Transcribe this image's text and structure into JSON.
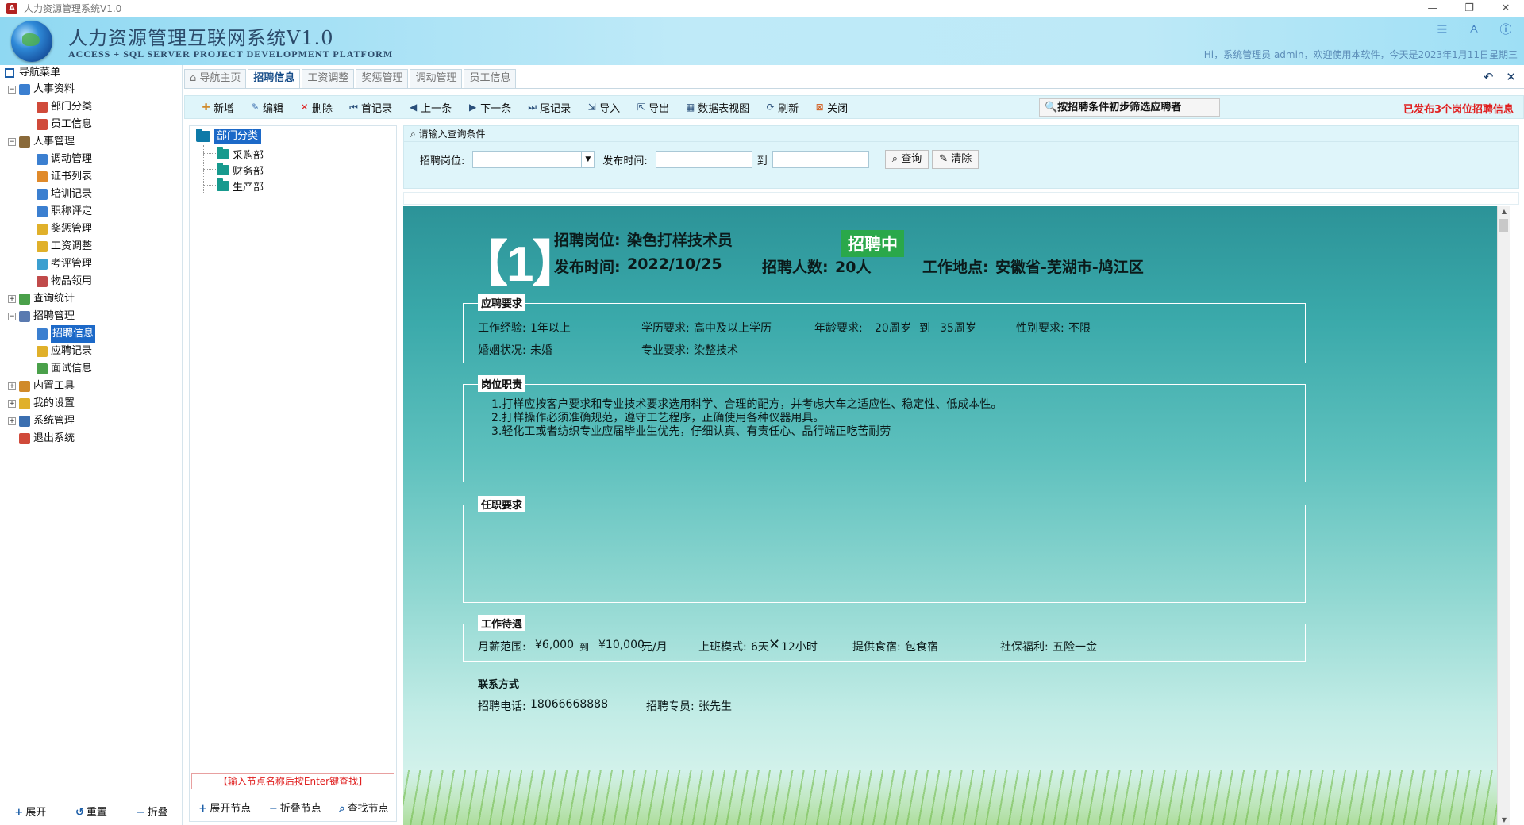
{
  "window": {
    "title": "人力资源管理系统V1.0",
    "app_badge": "A"
  },
  "banner": {
    "title": "人力资源管理互联网系统V1.0",
    "subtitle": "ACCESS + SQL SERVER PROJECT DEVELOPMENT PLATFORM",
    "welcome": "Hi，系统管理员 admin，欢迎使用本软件，今天是2023年1月11日星期三"
  },
  "nav": {
    "header": "导航菜单",
    "items": [
      {
        "label": "人事资料",
        "level": 0,
        "exp": "−",
        "color": "#3b7fd0"
      },
      {
        "label": "部门分类",
        "level": 1,
        "color": "#d04a3a"
      },
      {
        "label": "员工信息",
        "level": 1,
        "color": "#d04a3a"
      },
      {
        "label": "人事管理",
        "level": 0,
        "exp": "−",
        "color": "#8a6a3a"
      },
      {
        "label": "调动管理",
        "level": 1,
        "color": "#3b7fd0"
      },
      {
        "label": "证书列表",
        "level": 1,
        "color": "#e08a2a"
      },
      {
        "label": "培训记录",
        "level": 1,
        "color": "#3b7fd0"
      },
      {
        "label": "职称评定",
        "level": 1,
        "color": "#3b7fd0"
      },
      {
        "label": "奖惩管理",
        "level": 1,
        "color": "#e0b02a"
      },
      {
        "label": "工资调整",
        "level": 1,
        "color": "#e0b02a"
      },
      {
        "label": "考评管理",
        "level": 1,
        "color": "#3b9fd0"
      },
      {
        "label": "物品领用",
        "level": 1,
        "color": "#c04a4a"
      },
      {
        "label": "查询统计",
        "level": 0,
        "exp": "+",
        "color": "#4aa04a"
      },
      {
        "label": "招聘管理",
        "level": 0,
        "exp": "−",
        "color": "#5a7ab0"
      },
      {
        "label": "招聘信息",
        "level": 1,
        "color": "#3b7fd0",
        "selected": true
      },
      {
        "label": "应聘记录",
        "level": 1,
        "color": "#e0b02a"
      },
      {
        "label": "面试信息",
        "level": 1,
        "color": "#4aa04a"
      },
      {
        "label": "内置工具",
        "level": 0,
        "exp": "+",
        "color": "#d08a2a"
      },
      {
        "label": "我的设置",
        "level": 0,
        "exp": "+",
        "color": "#e0b02a"
      },
      {
        "label": "系统管理",
        "level": 0,
        "exp": "+",
        "color": "#3b6fb0"
      },
      {
        "label": "退出系统",
        "level": 0,
        "color": "#d04a3a"
      }
    ],
    "bottom": {
      "expand": "展开",
      "reset": "重置",
      "collapse": "折叠"
    }
  },
  "tabs": [
    {
      "label": "导航主页",
      "active": false
    },
    {
      "label": "招聘信息",
      "active": true
    },
    {
      "label": "工资调整",
      "active": false
    },
    {
      "label": "奖惩管理",
      "active": false
    },
    {
      "label": "调动管理",
      "active": false
    },
    {
      "label": "员工信息",
      "active": false
    }
  ],
  "toolbar": {
    "buttons": [
      {
        "label": "新增",
        "icon": "new-icon"
      },
      {
        "label": "编辑",
        "icon": "edit-icon"
      },
      {
        "label": "删除",
        "icon": "delete-icon"
      },
      {
        "label": "首记录",
        "icon": "first-record-icon"
      },
      {
        "label": "上一条",
        "icon": "prev-icon"
      },
      {
        "label": "下一条",
        "icon": "next-icon"
      },
      {
        "label": "尾记录",
        "icon": "last-record-icon"
      },
      {
        "label": "导入",
        "icon": "import-icon"
      },
      {
        "label": "导出",
        "icon": "export-icon"
      },
      {
        "label": "数据表视图",
        "icon": "datasheet-icon"
      },
      {
        "label": "刷新",
        "icon": "refresh-icon"
      },
      {
        "label": "关闭",
        "icon": "close-icon"
      }
    ],
    "filter_label": "按招聘条件初步筛选应聘者",
    "notice": "已发布3个岗位招聘信息"
  },
  "dept": {
    "root": "部门分类",
    "children": [
      "采购部",
      "财务部",
      "生产部"
    ],
    "hint": "【输入节点名称后按Enter键查找】",
    "bottom": {
      "expand": "展开节点",
      "collapse": "折叠节点",
      "find": "查找节点"
    }
  },
  "query": {
    "header": "请输入查询条件",
    "position_label": "招聘岗位:",
    "position_value": "",
    "time_label": "发布时间:",
    "time_from": "",
    "to_label": "到",
    "time_to": "",
    "search_btn": "查询",
    "clear_btn": "清除"
  },
  "job": {
    "index": "【1】",
    "position_label": "招聘岗位:",
    "position": "染色打样技术员",
    "status": "招聘中",
    "date_label": "发布时间:",
    "date": "2022/10/25",
    "count_label": "招聘人数:",
    "count": "20人",
    "location_label": "工作地点:",
    "location": "安徽省-芜湖市-鸠江区",
    "requirements": {
      "caption": "应聘要求",
      "exp_label": "工作经验:",
      "exp": "1年以上",
      "edu_label": "学历要求:",
      "edu": "高中及以上学历",
      "age_label": "年龄要求:",
      "age_from": "20周岁",
      "age_to_label": "到",
      "age_to": "35周岁",
      "gender_label": "性别要求:",
      "gender": "不限",
      "marital_label": "婚姻状况:",
      "marital": "未婚",
      "major_label": "专业要求:",
      "major": "染整技术"
    },
    "duties": {
      "caption": "岗位职责",
      "lines": [
        "1.打样应按客户要求和专业技术要求选用科学、合理的配方，并考虑大车之适应性、稳定性、低成本性。",
        "2.打样操作必须准确规范，遵守工艺程序，正确使用各种仪器用具。",
        "3.轻化工或者纺织专业应届毕业生优先，仔细认真、有责任心、品行端正吃苦耐劳"
      ]
    },
    "qualifications": {
      "caption": "任职要求"
    },
    "benefits": {
      "caption": "工作待遇",
      "salary_label": "月薪范围:",
      "salary_from": "¥6,000",
      "salary_to_label": "到",
      "salary_to": "¥10,000",
      "salary_unit": "元/月",
      "shift_label": "上班模式:",
      "shift_days": "6天",
      "shift_hours": "12小时",
      "board_label": "提供食宿:",
      "board": "包食宿",
      "insurance_label": "社保福利:",
      "insurance": "五险一金"
    },
    "contact": {
      "caption": "联系方式",
      "phone_label": "招聘电话:",
      "phone": "18066668888",
      "agent_label": "招聘专员:",
      "agent": "张先生"
    }
  }
}
